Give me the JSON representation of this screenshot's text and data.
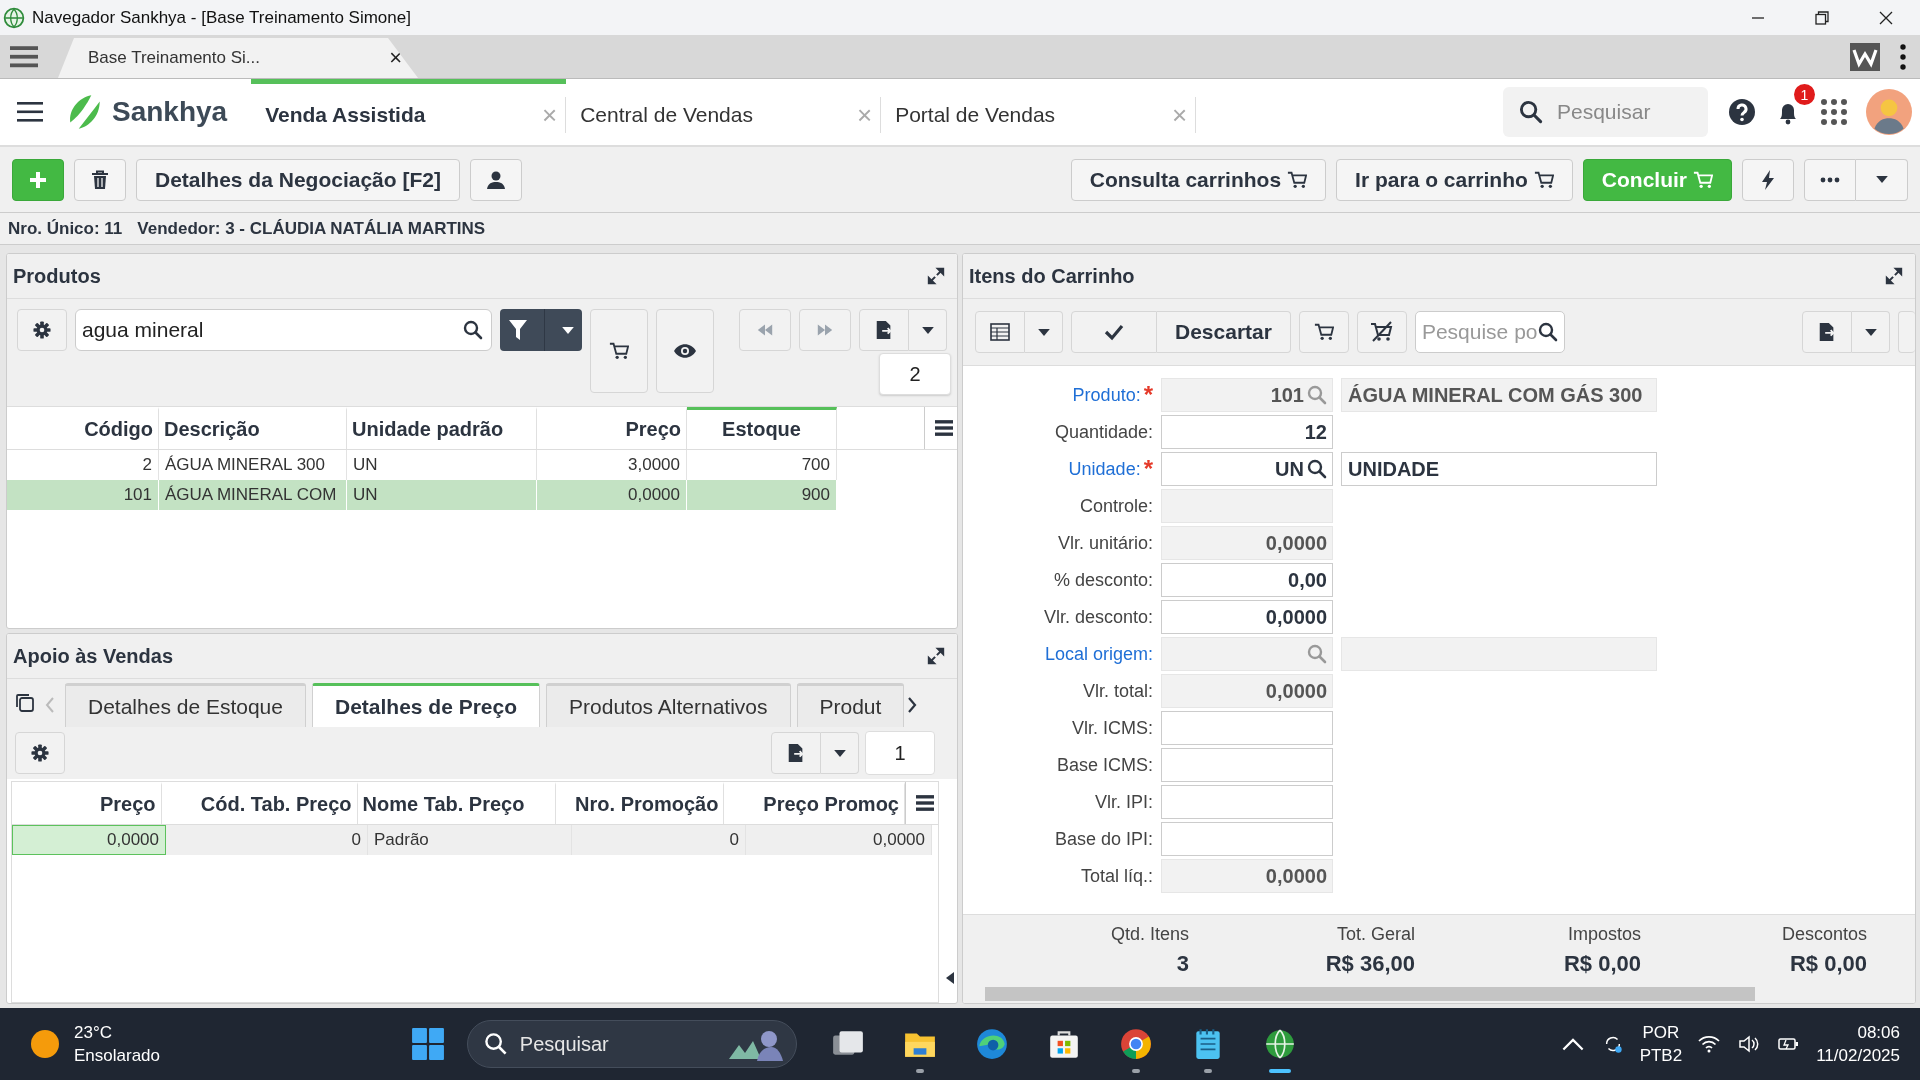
{
  "window": {
    "title": "Navegador Sankhya - [Base Treinamento Simone]"
  },
  "browser_tab": {
    "label": "Base Treinamento Si...",
    "close": "×"
  },
  "brand": "Sankhya",
  "app_tabs": [
    {
      "label": "Venda Assistida",
      "selected": true,
      "close": "×"
    },
    {
      "label": "Central de Vendas",
      "selected": false,
      "close": "×"
    },
    {
      "label": "Portal de Vendas",
      "selected": false,
      "close": "×"
    }
  ],
  "search": {
    "placeholder": "Pesquisar"
  },
  "notifications": {
    "count": "1"
  },
  "toolbar": {
    "details_button": "Detalhes da Negociação [F2]",
    "right_buttons": [
      {
        "label": "Consulta carrinhos",
        "kind": "plain"
      },
      {
        "label": "Ir para o carrinho",
        "kind": "plain"
      },
      {
        "label": "Concluir",
        "kind": "primary"
      }
    ]
  },
  "info": {
    "nro_unico": "Nro. Único: 11",
    "vendedor": "Vendedor: 3 - CLÁUDIA NATÁLIA MARTINS"
  },
  "produtos": {
    "title": "Produtos",
    "search_value": "agua mineral",
    "count": "2",
    "columns": [
      {
        "label": "Código",
        "active": false
      },
      {
        "label": "Descrição",
        "active": false
      },
      {
        "label": "Unidade padrão",
        "active": false
      },
      {
        "label": "Preço",
        "active": false
      },
      {
        "label": "Estoque",
        "active": true
      }
    ],
    "rows": [
      {
        "cells": [
          "2",
          "ÁGUA MINERAL 300",
          "UN",
          "3,0000",
          "700"
        ],
        "selected": false
      },
      {
        "cells": [
          "101",
          "ÁGUA MINERAL COM",
          "UN",
          "0,0000",
          "900"
        ],
        "selected": true
      }
    ]
  },
  "apoio": {
    "title": "Apoio às Vendas",
    "count": "1",
    "tabs": [
      {
        "label": "Detalhes de Estoque",
        "selected": false
      },
      {
        "label": "Detalhes de Preço",
        "selected": true
      },
      {
        "label": "Produtos Alternativos",
        "selected": false
      },
      {
        "label": "Produt",
        "selected": false
      }
    ],
    "columns": [
      "Preço",
      "Cód. Tab. Preço",
      "Nome Tab. Preço",
      "Nro. Promoção",
      "Preço Promoç"
    ],
    "rows": [
      {
        "cells": [
          {
            "text": "0,0000",
            "focused": true
          },
          {
            "text": "0",
            "focused": false
          },
          {
            "text": "Padrão",
            "focused": false
          },
          {
            "text": "0",
            "focused": false
          },
          {
            "text": "0,0000",
            "focused": false
          }
        ]
      }
    ]
  },
  "carrinho": {
    "title": "Itens do Carrinho",
    "discard": "Descartar",
    "search_placeholder": "Pesquise po",
    "required_mark": "*",
    "fields": [
      {
        "label": "Produto:",
        "link": true,
        "required": true,
        "editable": false,
        "lookup": true,
        "value": "101",
        "side": {
          "text": "ÁGUA MINERAL COM GÁS 300",
          "editable": false
        }
      },
      {
        "label": "Quantidade:",
        "link": false,
        "required": false,
        "editable": true,
        "lookup": false,
        "value": "12"
      },
      {
        "label": "Unidade:",
        "link": true,
        "required": true,
        "editable": true,
        "lookup": true,
        "value": "UN",
        "side": {
          "text": "UNIDADE",
          "editable": true
        }
      },
      {
        "label": "Controle:",
        "link": false,
        "required": false,
        "editable": false,
        "lookup": false
      },
      {
        "label": "Vlr. unitário:",
        "link": false,
        "required": false,
        "editable": false,
        "lookup": false,
        "value": "0,0000"
      },
      {
        "label": "% desconto:",
        "link": false,
        "required": false,
        "editable": true,
        "lookup": false,
        "value": "0,00"
      },
      {
        "label": "Vlr. desconto:",
        "link": false,
        "required": false,
        "editable": true,
        "lookup": false,
        "value": "0,0000"
      },
      {
        "label": "Local origem:",
        "link": true,
        "required": false,
        "editable": false,
        "lookup": true,
        "side": {
          "editable": false
        }
      },
      {
        "label": "Vlr. total:",
        "link": false,
        "required": false,
        "editable": false,
        "lookup": false,
        "value": "0,0000"
      },
      {
        "label": "Vlr. ICMS:",
        "link": false,
        "required": false,
        "editable": true,
        "lookup": false
      },
      {
        "label": "Base ICMS:",
        "link": false,
        "required": false,
        "editable": true,
        "lookup": false
      },
      {
        "label": "Vlr. IPI:",
        "link": false,
        "required": false,
        "editable": true,
        "lookup": false
      },
      {
        "label": "Base do IPI:",
        "link": false,
        "required": false,
        "editable": true,
        "lookup": false
      },
      {
        "label": "Total líq.:",
        "link": false,
        "required": false,
        "editable": false,
        "lookup": false,
        "value": "0,0000"
      }
    ],
    "summary": [
      {
        "label": "Qtd. Itens",
        "value": "3"
      },
      {
        "label": "Tot. Geral",
        "value": "R$ 36,00"
      },
      {
        "label": "Impostos",
        "value": "R$ 0,00"
      },
      {
        "label": "Descontos",
        "value": "R$ 0,00"
      }
    ]
  },
  "taskbar": {
    "temperature": "23°C",
    "weather": "Ensolarado",
    "search_placeholder": "Pesquisar",
    "language": "POR",
    "layout": "PTB2",
    "time": "08:06",
    "date": "11/02/2025",
    "apps": [
      {
        "kind": "taskview",
        "running": false,
        "active": false
      },
      {
        "kind": "files",
        "running": true,
        "active": false
      },
      {
        "kind": "edge",
        "running": false,
        "active": false
      },
      {
        "kind": "store",
        "running": false,
        "active": false
      },
      {
        "kind": "chrome",
        "running": true,
        "active": false
      },
      {
        "kind": "notepad",
        "running": true,
        "active": false
      },
      {
        "kind": "sankhya",
        "running": true,
        "active": true
      }
    ]
  }
}
